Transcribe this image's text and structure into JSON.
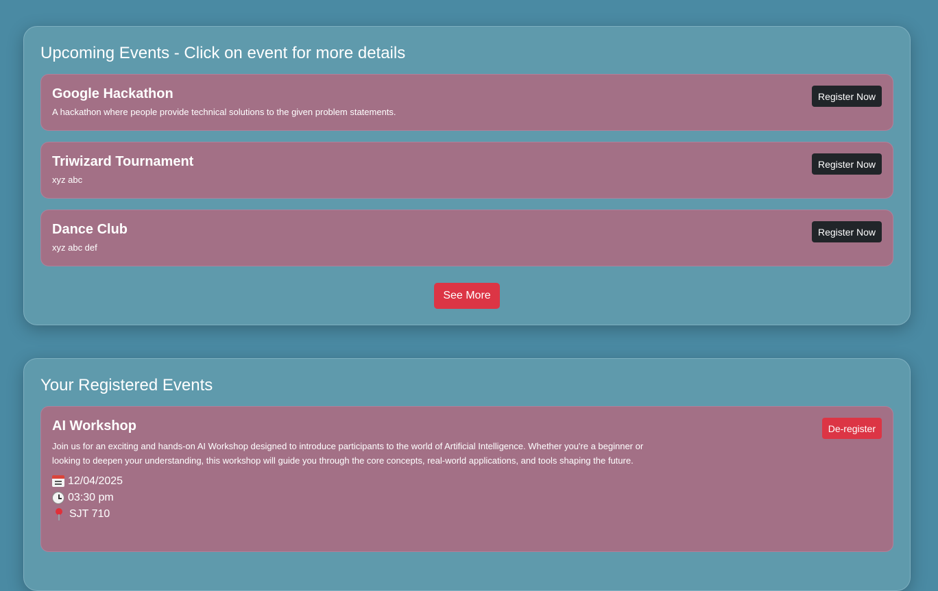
{
  "upcoming": {
    "title": "Upcoming Events - Click on event for more details",
    "events": [
      {
        "name": "Google Hackathon",
        "description": "A hackathon where people provide technical solutions to the given problem statements.",
        "button_label": "Register Now"
      },
      {
        "name": "Triwizard Tournament",
        "description": "xyz abc",
        "button_label": "Register Now"
      },
      {
        "name": "Dance Club",
        "description": "xyz abc def",
        "button_label": "Register Now"
      }
    ],
    "see_more_label": "See More"
  },
  "registered": {
    "title": "Your Registered Events",
    "events": [
      {
        "name": "AI Workshop",
        "description": "Join us for an exciting and hands-on AI Workshop designed to introduce participants to the world of Artificial Intelligence. Whether you're a beginner or looking to deepen your understanding, this workshop will guide you through the core concepts, real-world applications, and tools shaping the future.",
        "date": "12/04/2025",
        "time": "03:30 pm",
        "location": "SJT 710",
        "date_icon": "calendar-icon",
        "time_icon": "clock-icon",
        "location_icon": "pin-icon",
        "button_label": "De-register"
      }
    ]
  },
  "colors": {
    "background": "#4a8aa3",
    "panel": "#5f9aac",
    "card": "#a37086",
    "dark_button": "#212529",
    "red_button": "#dc3545"
  }
}
